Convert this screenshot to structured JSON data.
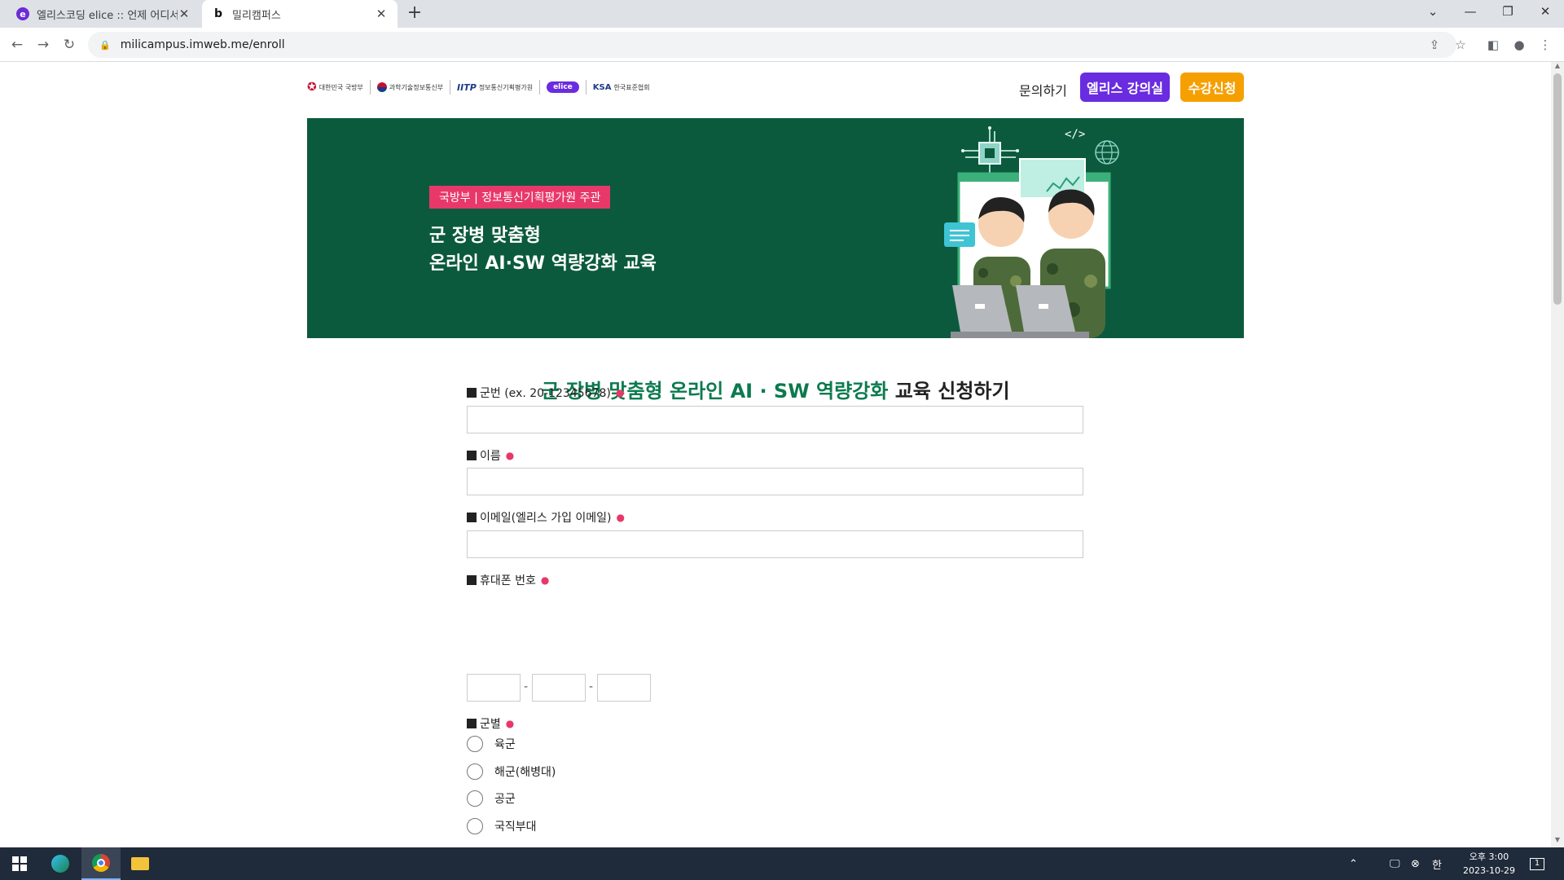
{
  "browser": {
    "tabs": [
      {
        "title": "엘리스코딩 elice :: 언제 어디서",
        "favicon": "elice-favicon",
        "active": false
      },
      {
        "title": "밀리캠퍼스",
        "favicon": "b",
        "active": true
      }
    ],
    "url": "milicampus.imweb.me/enroll"
  },
  "header": {
    "logos": {
      "mnd": "대한민국 국방부",
      "msit": "과학기술정보통신부",
      "iitp": "IITP",
      "iitp_name": "정보통신기획평가원",
      "elice": "elice",
      "ksa": "KSA",
      "ksa_name": "한국표준협회"
    },
    "inquiry": "문의하기",
    "classroom_button": "엘리스 강의실",
    "enroll_button": "수강신청"
  },
  "banner": {
    "tag": "국방부 | 정보통신기획평가원 주관",
    "line1": "군 장병 맞춤형",
    "line2": "온라인 AI·SW 역량강화 교육",
    "background": "#0b5a3d",
    "tag_color": "#e8386a"
  },
  "form": {
    "title_green": "군 장병 맞춤형 온라인 AI · SW 역량강화",
    "title_black": "교육 신청하기",
    "fields": {
      "service_number": "군번 (ex. 20-12345678)",
      "name": "이름",
      "email": "이메일(엘리스 가입 이메일)",
      "phone": "휴대폰 번호",
      "branch": "군별"
    },
    "phone_separator": "-",
    "branch_options": [
      "육군",
      "해군(해병대)",
      "공군",
      "국직부대"
    ]
  },
  "taskbar": {
    "time": "오후 3:00",
    "date": "2023-10-29",
    "notification_count": "1"
  },
  "colors": {
    "accent_purple": "#6a2ce0",
    "accent_orange": "#f5a000",
    "title_green": "#0b7a4f"
  }
}
